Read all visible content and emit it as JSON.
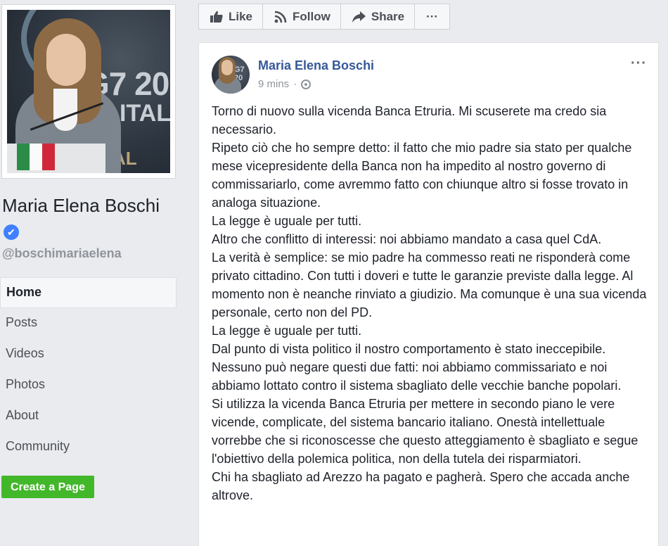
{
  "sidebar": {
    "page_name": "Maria Elena Boschi",
    "handle": "@boschimariaelena",
    "profile_photo_texts": [
      "G7 20",
      "ITALIA",
      "AL MEE"
    ],
    "nav": [
      {
        "label": "Home",
        "active": true
      },
      {
        "label": "Posts",
        "active": false
      },
      {
        "label": "Videos",
        "active": false
      },
      {
        "label": "Photos",
        "active": false
      },
      {
        "label": "About",
        "active": false
      },
      {
        "label": "Community",
        "active": false
      }
    ],
    "create_page_label": "Create a Page"
  },
  "actions": {
    "like": "Like",
    "follow": "Follow",
    "share": "Share",
    "more": "···"
  },
  "post": {
    "author": "Maria Elena Boschi",
    "time": "9 mins",
    "separator": "·",
    "lines": [
      "Torno di nuovo sulla vicenda Banca Etruria. Mi scuserete ma credo sia necessario.",
      "Ripeto ciò che ho sempre detto: il fatto che mio padre sia stato per qualche mese vicepresidente della Banca non ha impedito al nostro governo di commissariarlo, come avremmo fatto con chiunque altro si fosse trovato in analoga situazione.",
      "La legge è uguale per tutti.",
      "Altro che conflitto di interessi: noi abbiamo mandato a casa quel CdA.",
      "La verità è semplice: se mio padre ha commesso reati ne risponderà come privato cittadino. Con tutti i doveri e tutte le garanzie previste dalla legge. Al momento non è neanche rinviato a giudizio. Ma comunque è una sua vicenda personale, certo non del PD.",
      "La legge è uguale per tutti.",
      "Dal punto di vista politico il nostro comportamento è stato ineccepibile.",
      "Nessuno può negare questi due fatti: noi abbiamo commissariato e noi abbiamo lottato contro il sistema sbagliato delle vecchie banche popolari.",
      "Si utilizza la vicenda Banca Etruria per mettere in secondo piano le vere vicende, complicate, del sistema bancario italiano. Onestà intellettuale vorrebbe che si riconoscesse che questo atteggiamento è sbagliato e segue l'obiettivo della polemica politica, non della tutela dei risparmiatori.",
      "Chi ha sbagliato ad Arezzo ha pagato e pagherà. Spero che accada anche altrove."
    ]
  },
  "colors": {
    "link_blue": "#365899",
    "verified_blue": "#4080ff",
    "create_green": "#42b72a",
    "background": "#e9ebee"
  }
}
